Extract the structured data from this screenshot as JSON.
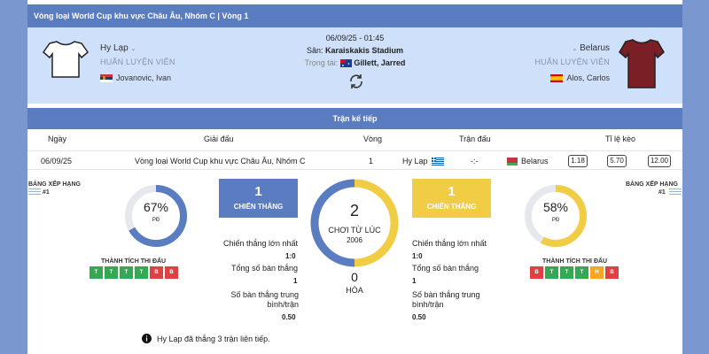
{
  "header": {
    "title": "Vòng loại World Cup khu vực Châu Âu, Nhóm C | Vòng 1"
  },
  "match": {
    "home": {
      "name": "Hy Lạp",
      "coach_label": "HUẤN LUYỆN VIÊN",
      "coach": "Jovanovic, Ivan",
      "shirt_color": "#ffffff"
    },
    "away": {
      "name": "Belarus",
      "coach_label": "HUẤN LUYỆN VIÊN",
      "coach": "Alos, Carlos",
      "shirt_color": "#7a1f25"
    },
    "datetime": "06/09/25 - 01:45",
    "stadium_label": "Sân:",
    "stadium": "Karaiskakis Stadium",
    "referee_label": "Trọng tài:",
    "referee": "Gillett, Jarred"
  },
  "next": {
    "title": "Trận kế tiếp",
    "headers": {
      "date": "Ngày",
      "league": "Giải đấu",
      "round": "Vòng",
      "match": "Trận đấu",
      "odds": "Tỉ lệ kèo"
    },
    "row": {
      "date": "06/09/25",
      "league": "Vòng loại World Cup khu vực Châu Âu, Nhóm C",
      "round": "1",
      "home": "Hy Lạp",
      "score": "-:-",
      "away": "Belarus",
      "odds": [
        "1.18",
        "5.70",
        "12.00"
      ]
    }
  },
  "stats": {
    "rank_label": "BẢNG XẾP HẠNG",
    "home_rank": "#1",
    "away_rank": "#1",
    "home_pct": "67%",
    "home_pct_value": 0.67,
    "away_pct": "58%",
    "away_pct_value": 0.58,
    "pd_label": "PĐ",
    "form_label": "THÀNH TÍCH THI ĐẤU",
    "home_form": [
      "T",
      "T",
      "T",
      "T",
      "B",
      "B"
    ],
    "away_form": [
      "B",
      "T",
      "T",
      "T",
      "H",
      "B"
    ],
    "home_wins": "1",
    "away_wins": "1",
    "wins_label": "CHIẾN THẮNG",
    "total_played": "2",
    "played_since_label": "CHƠI TỪ LÚC",
    "played_since_year": "2006",
    "draws": "0",
    "draws_label": "HÒA",
    "biggest_win_label": "Chiến thắng lớn nhất",
    "home_biggest_win": "1:0",
    "away_biggest_win": "1:0",
    "total_goals_label": "Tổng số bàn thắng",
    "home_total_goals": "1",
    "away_total_goals": "1",
    "avg_goals_label": "Số bàn thắng trung bình/trận",
    "home_avg_goals": "0.50",
    "away_avg_goals": "0.50",
    "note": "Hy Lạp đã thắng 3 trận liên tiếp."
  },
  "colors": {
    "blue": "#5a7cc0",
    "yellow": "#f0cd45",
    "green": "#34a853",
    "red": "#e04040",
    "orange": "#f5a623"
  }
}
